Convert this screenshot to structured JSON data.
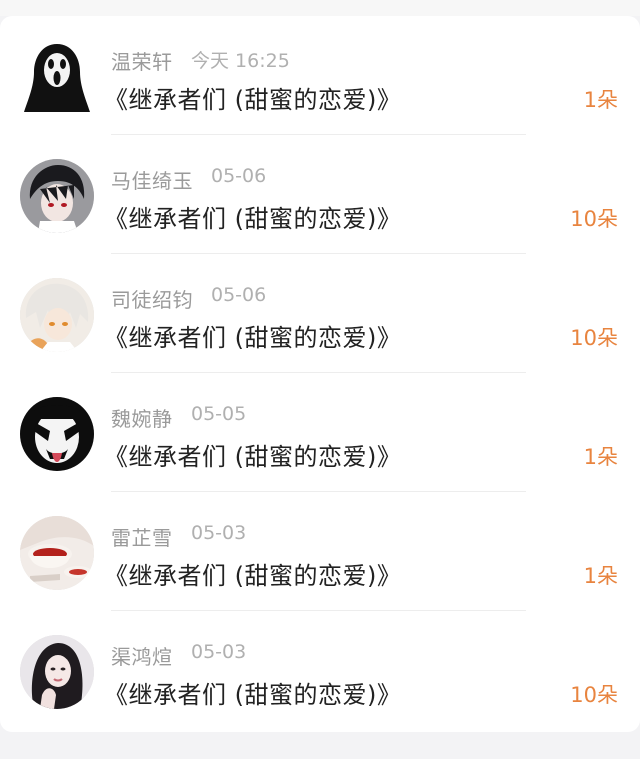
{
  "gifts": [
    {
      "name": "温荣轩",
      "time": "今天 16:25",
      "title": "《继承者们 (甜蜜的恋爱)》",
      "count": "1朵",
      "avatar": "scream-mask-avatar"
    },
    {
      "name": "马佳绮玉",
      "time": "05-06",
      "title": "《继承者们 (甜蜜的恋爱)》",
      "count": "10朵",
      "avatar": "anime-boy-avatar"
    },
    {
      "name": "司徒绍钧",
      "time": "05-06",
      "title": "《继承者们 (甜蜜的恋爱)》",
      "count": "10朵",
      "avatar": "white-hair-anime-avatar"
    },
    {
      "name": "魏婉静",
      "time": "05-05",
      "title": "《继承者们 (甜蜜的恋爱)》",
      "count": "1朵",
      "avatar": "kiss-face-paint-avatar"
    },
    {
      "name": "雷芷雪",
      "time": "05-03",
      "title": "《继承者们 (甜蜜的恋爱)》",
      "count": "1朵",
      "avatar": "tea-cup-avatar"
    },
    {
      "name": "渠鸿煊",
      "time": "05-03",
      "title": "《继承者们 (甜蜜的恋爱)》",
      "count": "10朵",
      "avatar": "portrait-girl-avatar"
    }
  ],
  "colors": {
    "accent": "#e8843f",
    "muted": "#9a9a9a",
    "text": "#222222"
  }
}
